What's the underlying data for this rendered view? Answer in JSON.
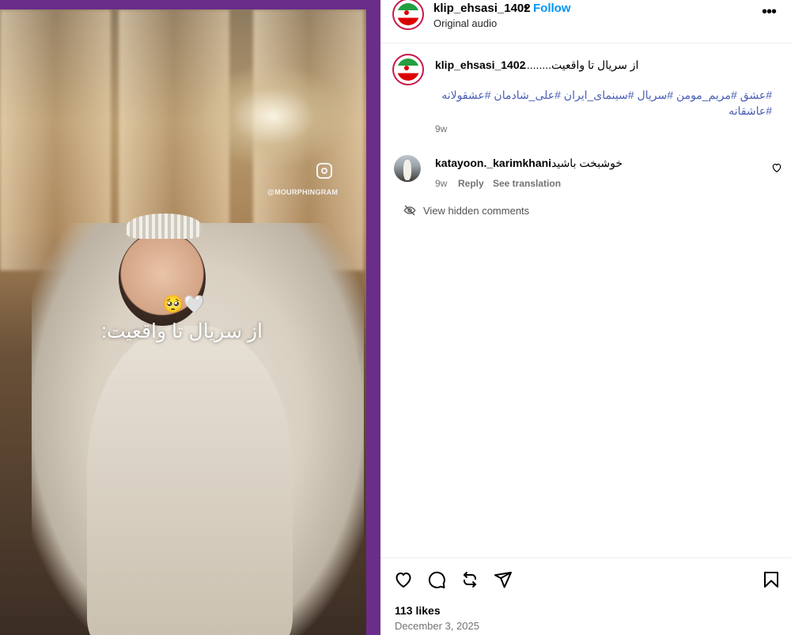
{
  "media": {
    "watermark": "@MOURPHINGRAM",
    "overlay_emoji": "🥺🤍",
    "overlay_text": "از سریال تا واقعیت:"
  },
  "header": {
    "username": "klip_ehsasi_1402",
    "separator": "•",
    "follow_label": "Follow",
    "audio_label": "Original audio",
    "more_label": "•••"
  },
  "caption": {
    "username": "klip_ehsasi_1402",
    "text": "از سریال تا واقعیت.........",
    "hashtags": "#عشق #مریم_مومن #سریال #سینمای_ایران #علی_شادمان #عشقولانه #عاشقانه",
    "age": "9w"
  },
  "comment": {
    "username": "katayoon._karimkhani",
    "text": "خوشبخت باشید",
    "age": "9w",
    "reply_label": "Reply",
    "translate_label": "See translation"
  },
  "hidden_comments_label": "View hidden comments",
  "footer": {
    "likes": "113 likes",
    "date": "December 3, 2025"
  },
  "icons": {
    "like": "heart-icon",
    "comment": "comment-icon",
    "share": "repost-icon",
    "send": "send-icon",
    "save": "bookmark-icon"
  },
  "colors": {
    "follow": "#0095f6",
    "hashtag": "#4a5fb5",
    "frame": "#6b2d8a",
    "avatar_ring": "#c9184a"
  }
}
